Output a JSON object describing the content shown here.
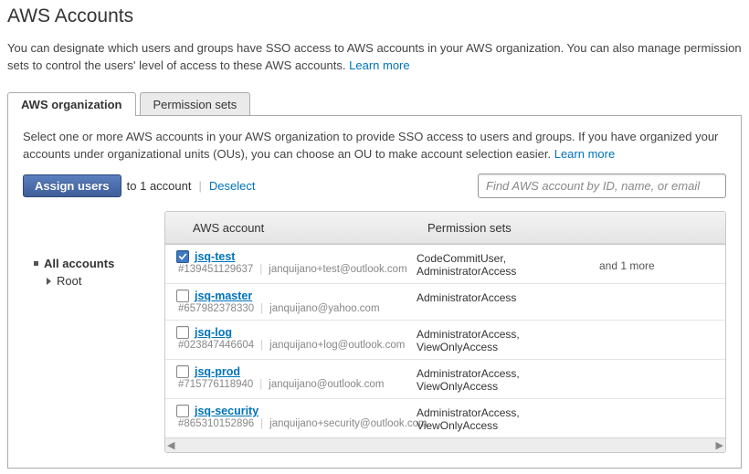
{
  "header": {
    "title": "AWS Accounts",
    "intro": "You can designate which users and groups have SSO access to AWS accounts in your AWS organization. You can also manage permission sets to control the users' level of access to these AWS accounts. ",
    "learn_more": "Learn more"
  },
  "tabs": {
    "org": "AWS organization",
    "psets": "Permission sets"
  },
  "panel": {
    "desc": "Select one or more AWS accounts in your AWS organization to provide SSO access to users and groups. If you have organized your accounts under organizational units (OUs), you can choose an OU to make account selection easier. ",
    "learn_more": "Learn more",
    "assign_btn": "Assign users",
    "assign_tail": "to 1 account",
    "deselect": "Deselect",
    "search_placeholder": "Find AWS account by ID, name, or email"
  },
  "tree": {
    "all": "All accounts",
    "root": "Root"
  },
  "table": {
    "col_account": "AWS account",
    "col_psets": "Permission sets"
  },
  "rows": [
    {
      "checked": true,
      "name": "jsq-test",
      "id": "#139451129637",
      "email": "janquijano+test@outlook.com",
      "psets": "CodeCommitUser, AdministratorAccess",
      "more": "and 1 more"
    },
    {
      "checked": false,
      "name": "jsq-master",
      "id": "#657982378330",
      "email": "janquijano@yahoo.com",
      "psets": "AdministratorAccess",
      "more": ""
    },
    {
      "checked": false,
      "name": "jsq-log",
      "id": "#023847446604",
      "email": "janquijano+log@outlook.com",
      "psets": "AdministratorAccess, ViewOnlyAccess",
      "more": ""
    },
    {
      "checked": false,
      "name": "jsq-prod",
      "id": "#715776118940",
      "email": "janquijano@outlook.com",
      "psets": "AdministratorAccess, ViewOnlyAccess",
      "more": ""
    },
    {
      "checked": false,
      "name": "jsq-security",
      "id": "#865310152896",
      "email": "janquijano+security@outlook.com",
      "psets": "AdministratorAccess, ViewOnlyAccess",
      "more": ""
    }
  ]
}
